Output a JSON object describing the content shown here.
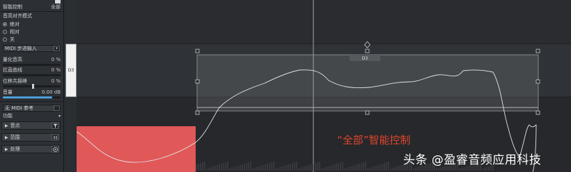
{
  "inspector": {
    "smart_control_label": "智能控制",
    "smart_control_value": "全部",
    "pitch_align_mode_label": "音高对齐模式",
    "modes": [
      {
        "label": "绝对",
        "selected": true
      },
      {
        "label": "相对",
        "selected": false
      },
      {
        "label": "关",
        "selected": false
      }
    ],
    "midi_step_input_label": "MIDI 步进输入",
    "quantize_pitch_label": "量化音高",
    "quantize_pitch_value": "0 %",
    "straighten_curve_label": "拉直曲线",
    "straighten_curve_value": "0 %",
    "shift_formant_label": "位移共振峰",
    "shift_formant_value": "0 %",
    "volume_label": "音量",
    "volume_value": "0.00 dB",
    "volume_level": 0.85,
    "no_midi_ref_label": "无 MIDI 参考",
    "function_label": "功能",
    "sections": [
      {
        "label": "音点",
        "icon": "funnel-icon"
      },
      {
        "label": "范围",
        "icon": "bars-icon"
      },
      {
        "label": "处理",
        "icon": "play-icon"
      }
    ]
  },
  "editor": {
    "key_label": "D3",
    "segment_label": "D3"
  },
  "colors": {
    "accent_blue": "#4b9fd5",
    "note_red": "#e05858",
    "overlay_text": "#e2452d"
  },
  "overlay": {
    "annotation": "“全部”智能控制",
    "watermark": "头条 @盈睿音频应用科技"
  }
}
